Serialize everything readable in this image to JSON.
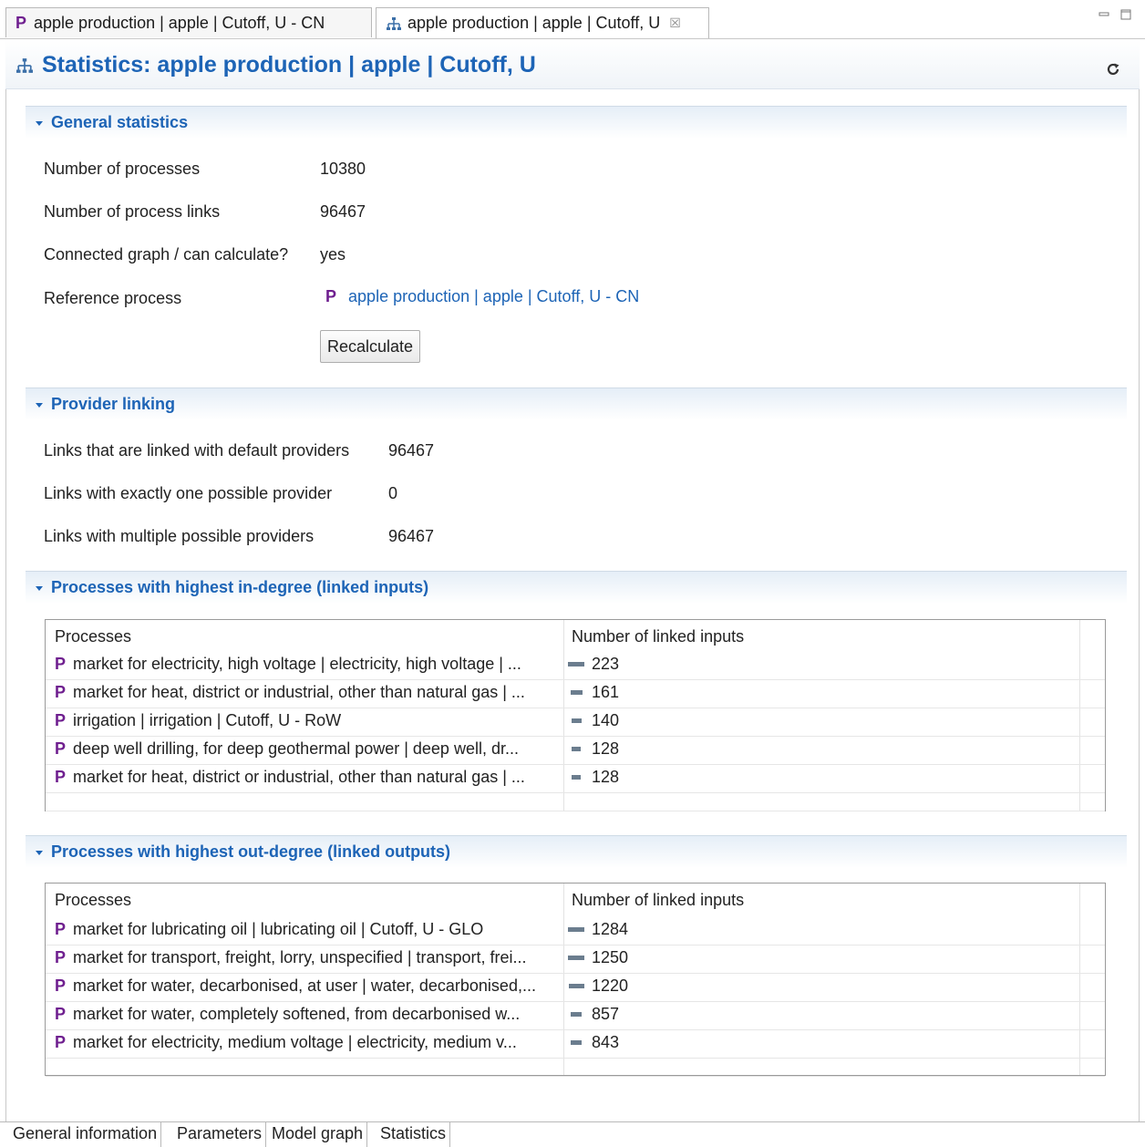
{
  "tabs": [
    {
      "label": "apple production | apple | Cutoff, U - CN",
      "badge": "P"
    },
    {
      "label": "apple production | apple | Cutoff, U",
      "close": "☒"
    }
  ],
  "header": {
    "title": "Statistics: apple production | apple | Cutoff, U"
  },
  "general": {
    "heading": "General statistics",
    "rows": [
      {
        "label": "Number of processes",
        "value": "10380"
      },
      {
        "label": "Number of process links",
        "value": "96467"
      },
      {
        "label": "Connected graph / can calculate?",
        "value": "yes"
      },
      {
        "label": "Reference process",
        "value": "apple production | apple | Cutoff, U - CN",
        "badge": "P"
      }
    ],
    "recalculate_label": "Recalculate"
  },
  "provider": {
    "heading": "Provider linking",
    "rows": [
      {
        "label": "Links that are linked with default providers",
        "value": "96467"
      },
      {
        "label": "Links with exactly one possible provider",
        "value": "0"
      },
      {
        "label": "Links with multiple possible providers",
        "value": "96467"
      }
    ]
  },
  "indegree": {
    "heading": "Processes with highest in-degree (linked inputs)",
    "col1": "Processes",
    "col2": "Number of linked inputs",
    "rows": [
      {
        "badge": "P",
        "name": "market for electricity, high voltage | electricity, high voltage | ...",
        "value": 223
      },
      {
        "badge": "P",
        "name": "market for heat, district or industrial, other than natural gas | ...",
        "value": 161
      },
      {
        "badge": "P",
        "name": "irrigation | irrigation | Cutoff, U - RoW",
        "value": 140
      },
      {
        "badge": "P",
        "name": "deep well drilling, for deep geothermal power | deep well, dr...",
        "value": 128
      },
      {
        "badge": "P",
        "name": "market for heat, district or industrial, other than natural gas | ...",
        "value": 128
      }
    ]
  },
  "outdegree": {
    "heading": "Processes with highest out-degree (linked outputs)",
    "col1": "Processes",
    "col2": "Number of linked inputs",
    "rows": [
      {
        "badge": "P",
        "name": "market for lubricating oil | lubricating oil | Cutoff, U - GLO",
        "value": 1284
      },
      {
        "badge": "P",
        "name": "market for transport, freight, lorry, unspecified | transport, frei...",
        "value": 1250
      },
      {
        "badge": "P",
        "name": "market for water, decarbonised, at user | water, decarbonised,...",
        "value": 1220
      },
      {
        "badge": "P",
        "name": "market for water, completely softened, from decarbonised w...",
        "value": 857
      },
      {
        "badge": "P",
        "name": "market for electricity, medium voltage | electricity, medium v...",
        "value": 843
      }
    ]
  },
  "pagetabs": [
    "General information",
    "Parameters",
    "Model graph",
    "Statistics"
  ],
  "colors": {
    "accent": "#1d64b6",
    "process_badge": "#6f1f8f",
    "bar": "#6b7d8e"
  },
  "icons": [
    "process-icon",
    "graph-icon",
    "close-icon",
    "minimize-icon",
    "maximize-icon",
    "refresh-icon",
    "twisty-icon"
  ]
}
